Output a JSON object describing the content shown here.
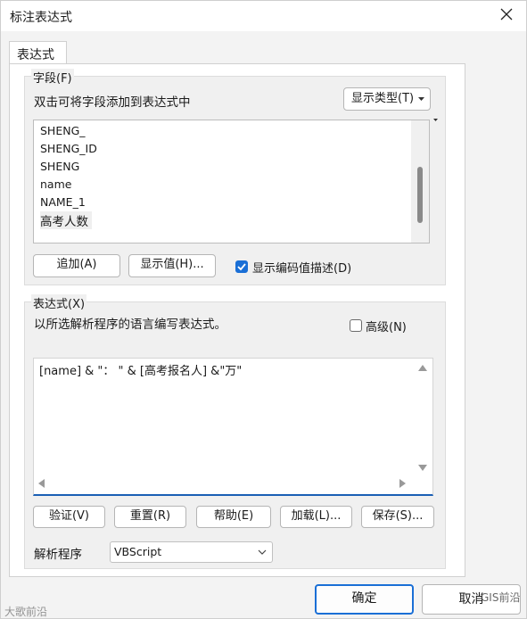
{
  "window": {
    "title": "标注表达式"
  },
  "tab": {
    "label": "表达式"
  },
  "fields": {
    "group_title": "字段(F)",
    "instruction": "双击可将字段添加到表达式中",
    "show_type_button": "显示类型(T)",
    "items": [
      "SHENG_",
      "SHENG_ID",
      "SHENG",
      "name",
      "NAME_1",
      "高考人数"
    ],
    "add_button": "追加(A)",
    "show_values_button": "显示值(H)...",
    "show_coded_desc_label": "显示编码值描述(D)",
    "show_coded_desc_checked": true
  },
  "expression": {
    "group_title": "表达式(X)",
    "instruction": "以所选解析程序的语言编写表达式。",
    "advanced_label": "高级(N)",
    "advanced_checked": false,
    "text": "[name] & \"： \" & [高考报名人] &\"万\"",
    "buttons": {
      "verify": "验证(V)",
      "reset": "重置(R)",
      "help": "帮助(E)",
      "load": "加载(L)...",
      "save": "保存(S)..."
    },
    "parser_label": "解析程序",
    "parser_value": "VBScript"
  },
  "footer": {
    "ok_button": "确定",
    "cancel_button": "取消"
  },
  "watermarks": {
    "left": "大歌前沿",
    "right": "GIS前沿"
  },
  "colors": {
    "accent": "#1a6fd6",
    "underline": "#1a5fb4"
  }
}
